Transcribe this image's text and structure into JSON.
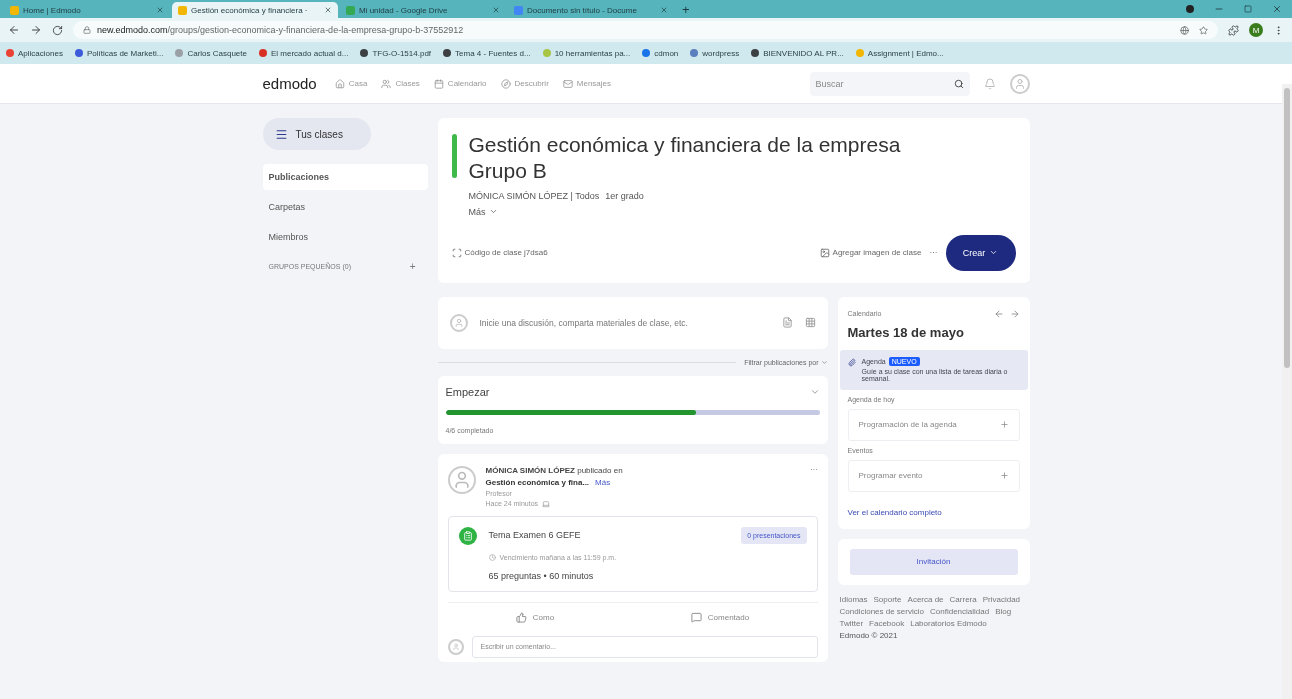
{
  "browser": {
    "tabs": [
      {
        "title": "Home | Edmodo",
        "selected": false,
        "color": "#f2b705"
      },
      {
        "title": "Gestión económica y financiera ·",
        "selected": true,
        "color": "#f2b705"
      },
      {
        "title": "Mi unidad - Google Drive",
        "selected": false,
        "color": "#34a853"
      },
      {
        "title": "Documento sin título - Docume",
        "selected": false,
        "color": "#4285f4"
      }
    ],
    "new_tab": "+",
    "url": {
      "host": "new.edmodo.com",
      "path": "/groups/gestion-economica-y-financiera-de-la-empresa-grupo-b-37552912"
    },
    "profile_initial": "M",
    "bookmarks": [
      {
        "label": "Aplicaciones",
        "color": "#ea4335"
      },
      {
        "label": "Políticas de Marketi...",
        "color": "#3b5bdb"
      },
      {
        "label": "Carlos Casquete",
        "color": "#9aa0a6"
      },
      {
        "label": "El mercado actual d...",
        "color": "#d93025"
      },
      {
        "label": "TFG-O-1514.pdf",
        "color": "#3c4043"
      },
      {
        "label": "Tema 4 - Fuentes d...",
        "color": "#3c4043"
      },
      {
        "label": "10 herramientas pa...",
        "color": "#a8c545"
      },
      {
        "label": "cdmon",
        "color": "#1a73e8"
      },
      {
        "label": "wordpress",
        "color": "#5b7fbf"
      },
      {
        "label": "BIENVENIDO AL PR...",
        "color": "#3c4043"
      },
      {
        "label": "Assignment | Edmo...",
        "color": "#f2b705"
      }
    ]
  },
  "nav": {
    "logo": "edmodo",
    "items": [
      {
        "label": "Casa",
        "kind": "home"
      },
      {
        "label": "Clases",
        "kind": "classes"
      },
      {
        "label": "Calendario",
        "kind": "calendar"
      },
      {
        "label": "Descubrir",
        "kind": "discover"
      },
      {
        "label": "Mensajes",
        "kind": "messages"
      }
    ],
    "search": {
      "placeholder": "Buscar"
    }
  },
  "sidebar": {
    "classes_button": "Tus clases",
    "items": [
      {
        "label": "Publicaciones",
        "selected": true
      },
      {
        "label": "Carpetas",
        "selected": false
      },
      {
        "label": "Miembros",
        "selected": false
      }
    ],
    "groups": "GRUPOS PEQUEÑOS (0)",
    "add": "+"
  },
  "class": {
    "title": "Gestión económica y financiera de la empresa Grupo B",
    "owner": "MÓNICA SIMÓN LÓPEZ | Todos",
    "grade": "1er grado",
    "more": "Más",
    "code": "Código de clase j7dsa6",
    "add_image": "Agregar imagen de clase",
    "options": "···",
    "create": "Crear"
  },
  "composer": {
    "placeholder": "Inicie una discusión, comparta materiales de clase, etc."
  },
  "filter": "Filtrar publicaciones por",
  "progress": {
    "title": "Empezar",
    "level": 0.67,
    "status": "4/6 completado"
  },
  "post": {
    "headline": "**MÓNICA SIMÓN LÓPEZ** publicado en",
    "group": "Gestión económica y fina...",
    "more": "Más",
    "role": "Profesor",
    "time": "Hace 24 minutos",
    "options": "···",
    "quiz": {
      "title": "Tema Examen 6 GEFE",
      "submissions": "0 presentaciones",
      "due": "Vencimiento mañana a las 11:59 p.m.",
      "stats": "65 preguntas • 60 minutos"
    },
    "actions": [
      {
        "label": "Como",
        "kind": "like"
      },
      {
        "label": "Comentado",
        "kind": "comment"
      }
    ],
    "comment_placeholder": "Escribir un comentario..."
  },
  "calendar": {
    "label": "Calendario",
    "date": "Martes 18 de mayo",
    "agenda": {
      "title": "Agenda",
      "badge": "NUEVO",
      "text": "Guíe a su clase con una lista de tareas diaria o semanal."
    },
    "today_label": "Agenda de hoy",
    "today_placeholder": "Programación de la agenda",
    "events_label": "Eventos",
    "events_placeholder": "Programar evento",
    "link": "Ver el calendario completo"
  },
  "invite": "Invitación",
  "footer": {
    "links": [
      "Idiomas",
      "Soporte",
      "Acerca de",
      "Carrera",
      "Privacidad",
      "Condiciones de servicio",
      "Confidencialidad",
      "Blog",
      "Twitter",
      "Facebook",
      "Laboratorios Edmodo"
    ],
    "copyright": "Edmodo © 2021"
  }
}
